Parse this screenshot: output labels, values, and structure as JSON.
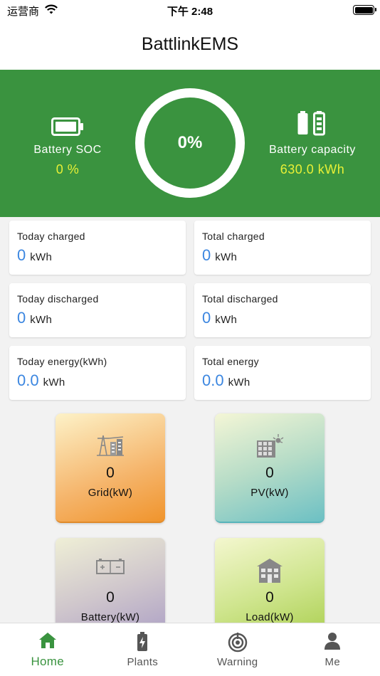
{
  "status_bar": {
    "carrier": "运营商",
    "time": "下午 2:48"
  },
  "app": {
    "title": "BattlinkEMS",
    "accent_color": "#3a933f",
    "value_color": "#e8f036",
    "number_color": "#3b86e0"
  },
  "hero": {
    "soc_label": "Battery SOC",
    "soc_value": "0 %",
    "ring_value": "0%",
    "ring_fill_fraction": 0,
    "capacity_label": "Battery capacity",
    "capacity_value": "630.0 kWh"
  },
  "stats": [
    {
      "name": "Today charged",
      "value": "0",
      "unit": "kWh"
    },
    {
      "name": "Total charged",
      "value": "0",
      "unit": "kWh"
    },
    {
      "name": "Today discharged",
      "value": "0",
      "unit": "kWh"
    },
    {
      "name": "Total discharged",
      "value": "0",
      "unit": "kWh"
    },
    {
      "name": "Today energy(kWh)",
      "value": "0.0",
      "unit": "kWh"
    },
    {
      "name": "Total energy",
      "value": "0.0",
      "unit": "kWh"
    }
  ],
  "tiles": [
    {
      "icon": "grid-tower-icon",
      "value": "0",
      "label": "Grid(kW)"
    },
    {
      "icon": "solar-panel-icon",
      "value": "0",
      "label": "PV(kW)"
    },
    {
      "icon": "battery-pack-icon",
      "value": "0",
      "label": "Battery(kW)"
    },
    {
      "icon": "building-load-icon",
      "value": "0",
      "label": "Load(kW)"
    }
  ],
  "tabs": [
    {
      "icon": "home-icon",
      "label": "Home",
      "active": true
    },
    {
      "icon": "battery-plants-icon",
      "label": "Plants",
      "active": false
    },
    {
      "icon": "warning-signal-icon",
      "label": "Warning",
      "active": false
    },
    {
      "icon": "person-icon",
      "label": "Me",
      "active": false
    }
  ]
}
